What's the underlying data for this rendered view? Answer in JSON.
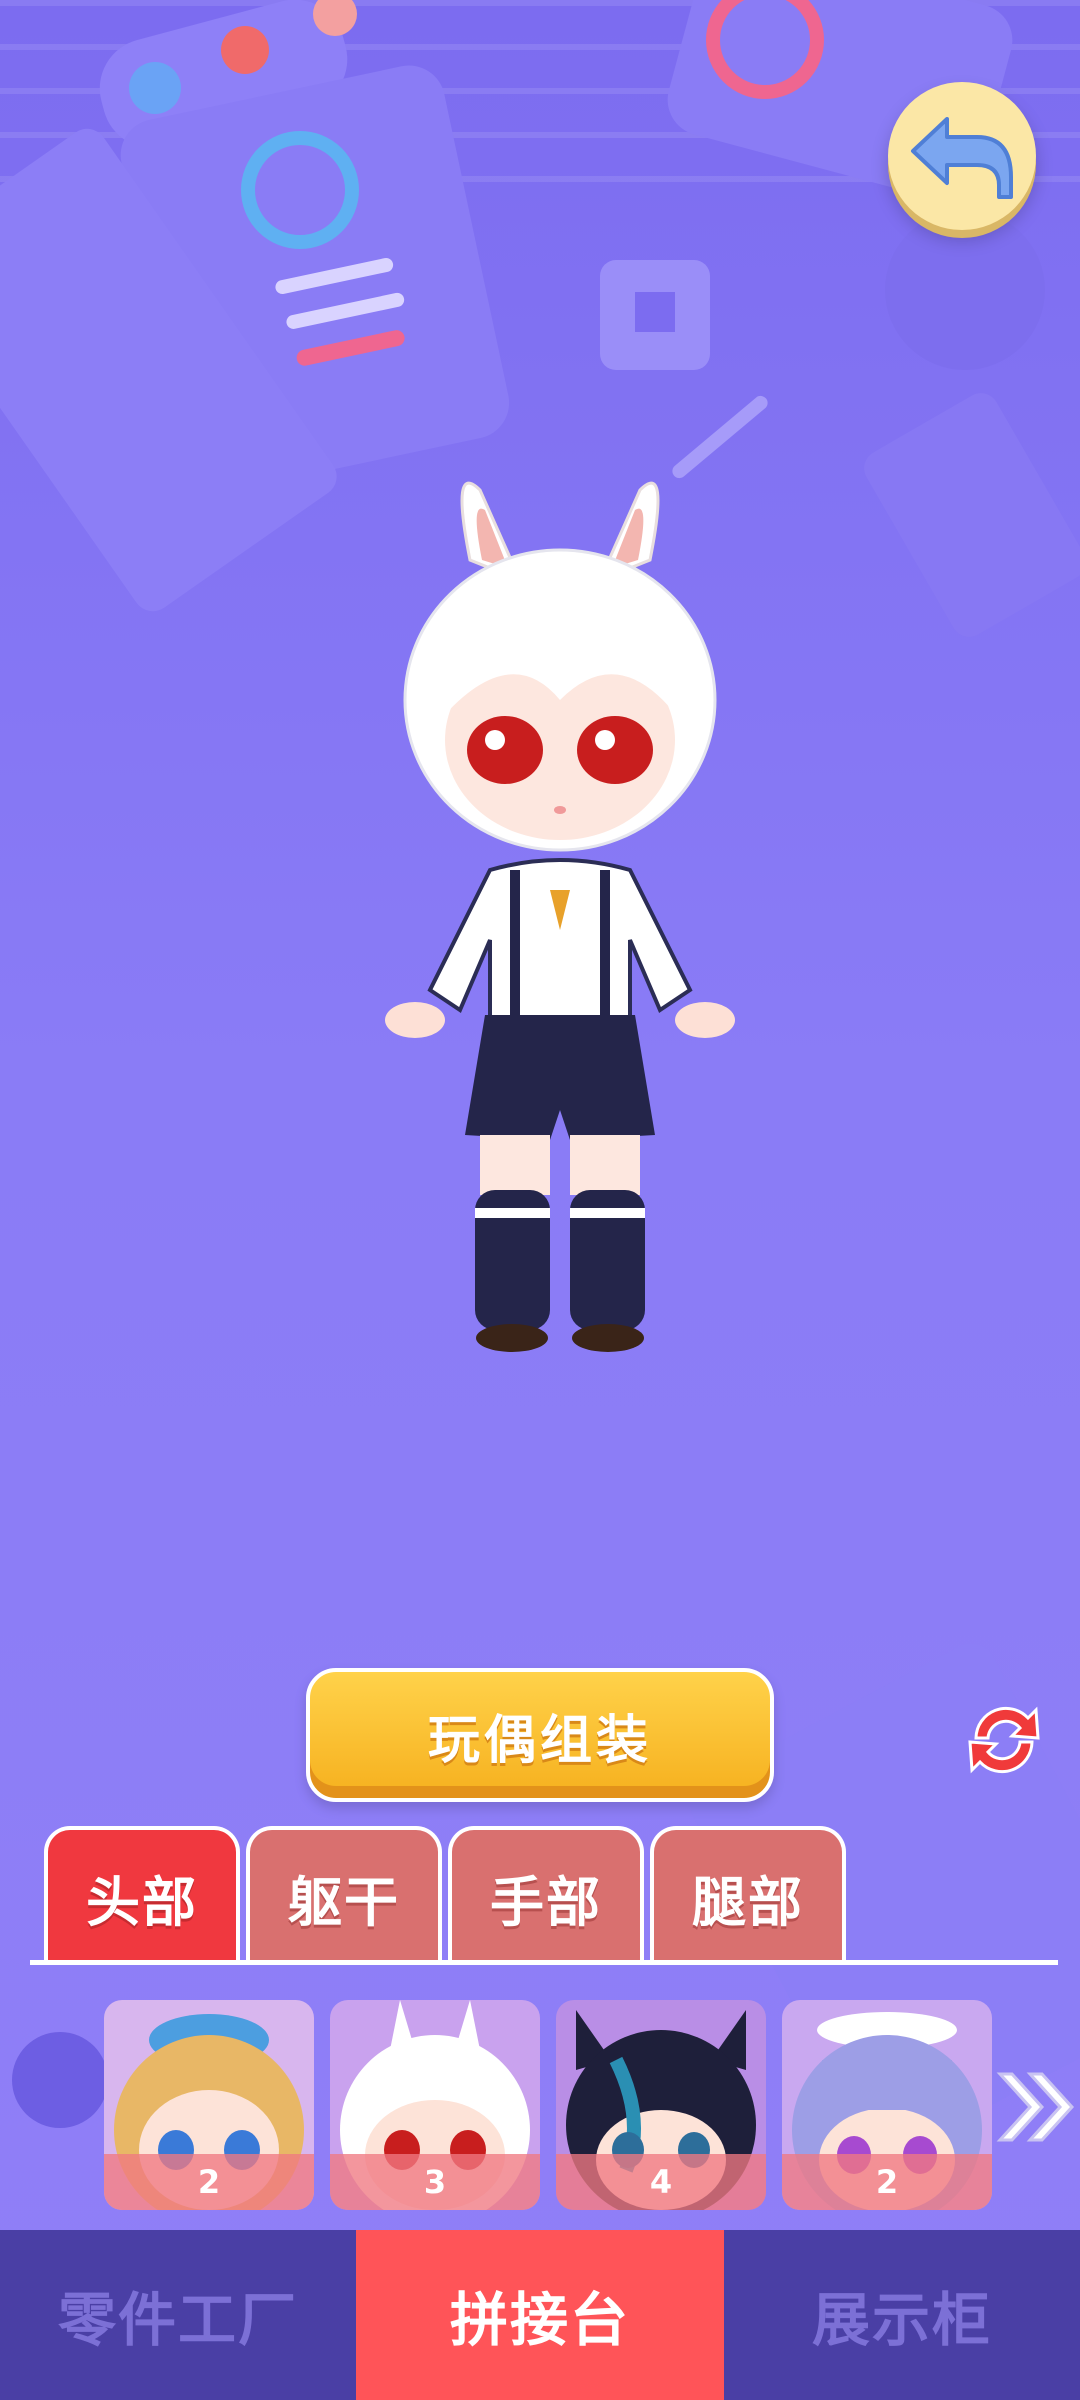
{
  "header": {
    "back_icon": "back-arrow-icon"
  },
  "main": {
    "assemble_label": "玩偶组装",
    "refresh_icon": "refresh-icon"
  },
  "tabs": [
    {
      "label": "头部",
      "active": true
    },
    {
      "label": "躯干",
      "active": false
    },
    {
      "label": "手部",
      "active": false
    },
    {
      "label": "腿部",
      "active": false
    }
  ],
  "parts": [
    {
      "count": "2",
      "hair": "blonde-hat"
    },
    {
      "count": "3",
      "hair": "white-bunny"
    },
    {
      "count": "4",
      "hair": "black-cat"
    },
    {
      "count": "2",
      "hair": "lavender-maid"
    }
  ],
  "next_icon": "double-chevron-right-icon",
  "bottom_nav": [
    {
      "label": "零件工厂",
      "active": false
    },
    {
      "label": "拼接台",
      "active": true
    },
    {
      "label": "展示柜",
      "active": false
    }
  ],
  "colors": {
    "accent": "#ff5458",
    "tab_active": "#f0383f",
    "button": "#f6b01e",
    "nav_bg": "#4a3fa5"
  }
}
